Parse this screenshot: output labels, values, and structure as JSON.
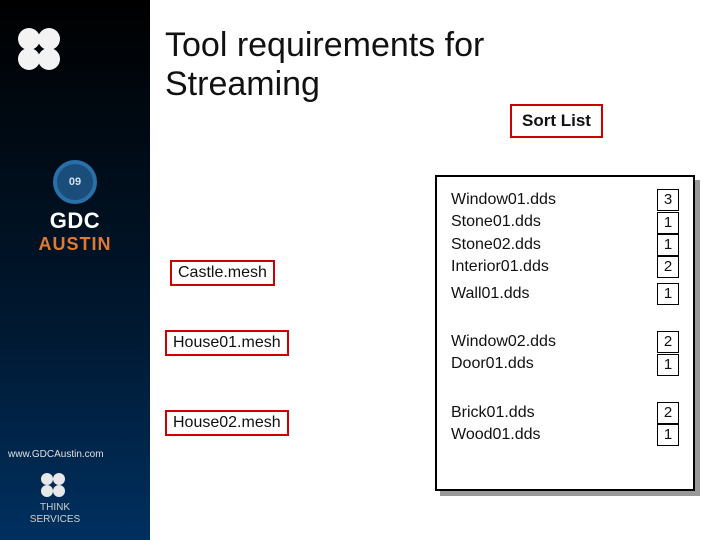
{
  "title_line1": "Tool requirements for",
  "title_line2": "Streaming",
  "sort_label": "Sort List",
  "meshes": {
    "castle": "Castle.mesh",
    "house01": "House01.mesh",
    "house02": "House02.mesh"
  },
  "dds_group1": [
    {
      "name": "Window01.dds",
      "count": "3"
    },
    {
      "name": "Stone01.dds",
      "count": "1"
    },
    {
      "name": "Stone02.dds",
      "count": "1"
    },
    {
      "name": "Interior01.dds",
      "count": "2"
    }
  ],
  "dds_group1_extra": {
    "name": "Wall01.dds",
    "count": "1"
  },
  "dds_group2": [
    {
      "name": "Window02.dds",
      "count": "2"
    },
    {
      "name": "Door01.dds",
      "count": "1"
    }
  ],
  "dds_group3": [
    {
      "name": "Brick01.dds",
      "count": "2"
    },
    {
      "name": "Wood01.dds",
      "count": "1"
    }
  ],
  "sidebar": {
    "badge_year": "09",
    "gdc": "GDC",
    "austin": "AUSTIN",
    "url": "www.GDCAustin.com",
    "think1": "THINK",
    "think2": "SERVICES"
  }
}
